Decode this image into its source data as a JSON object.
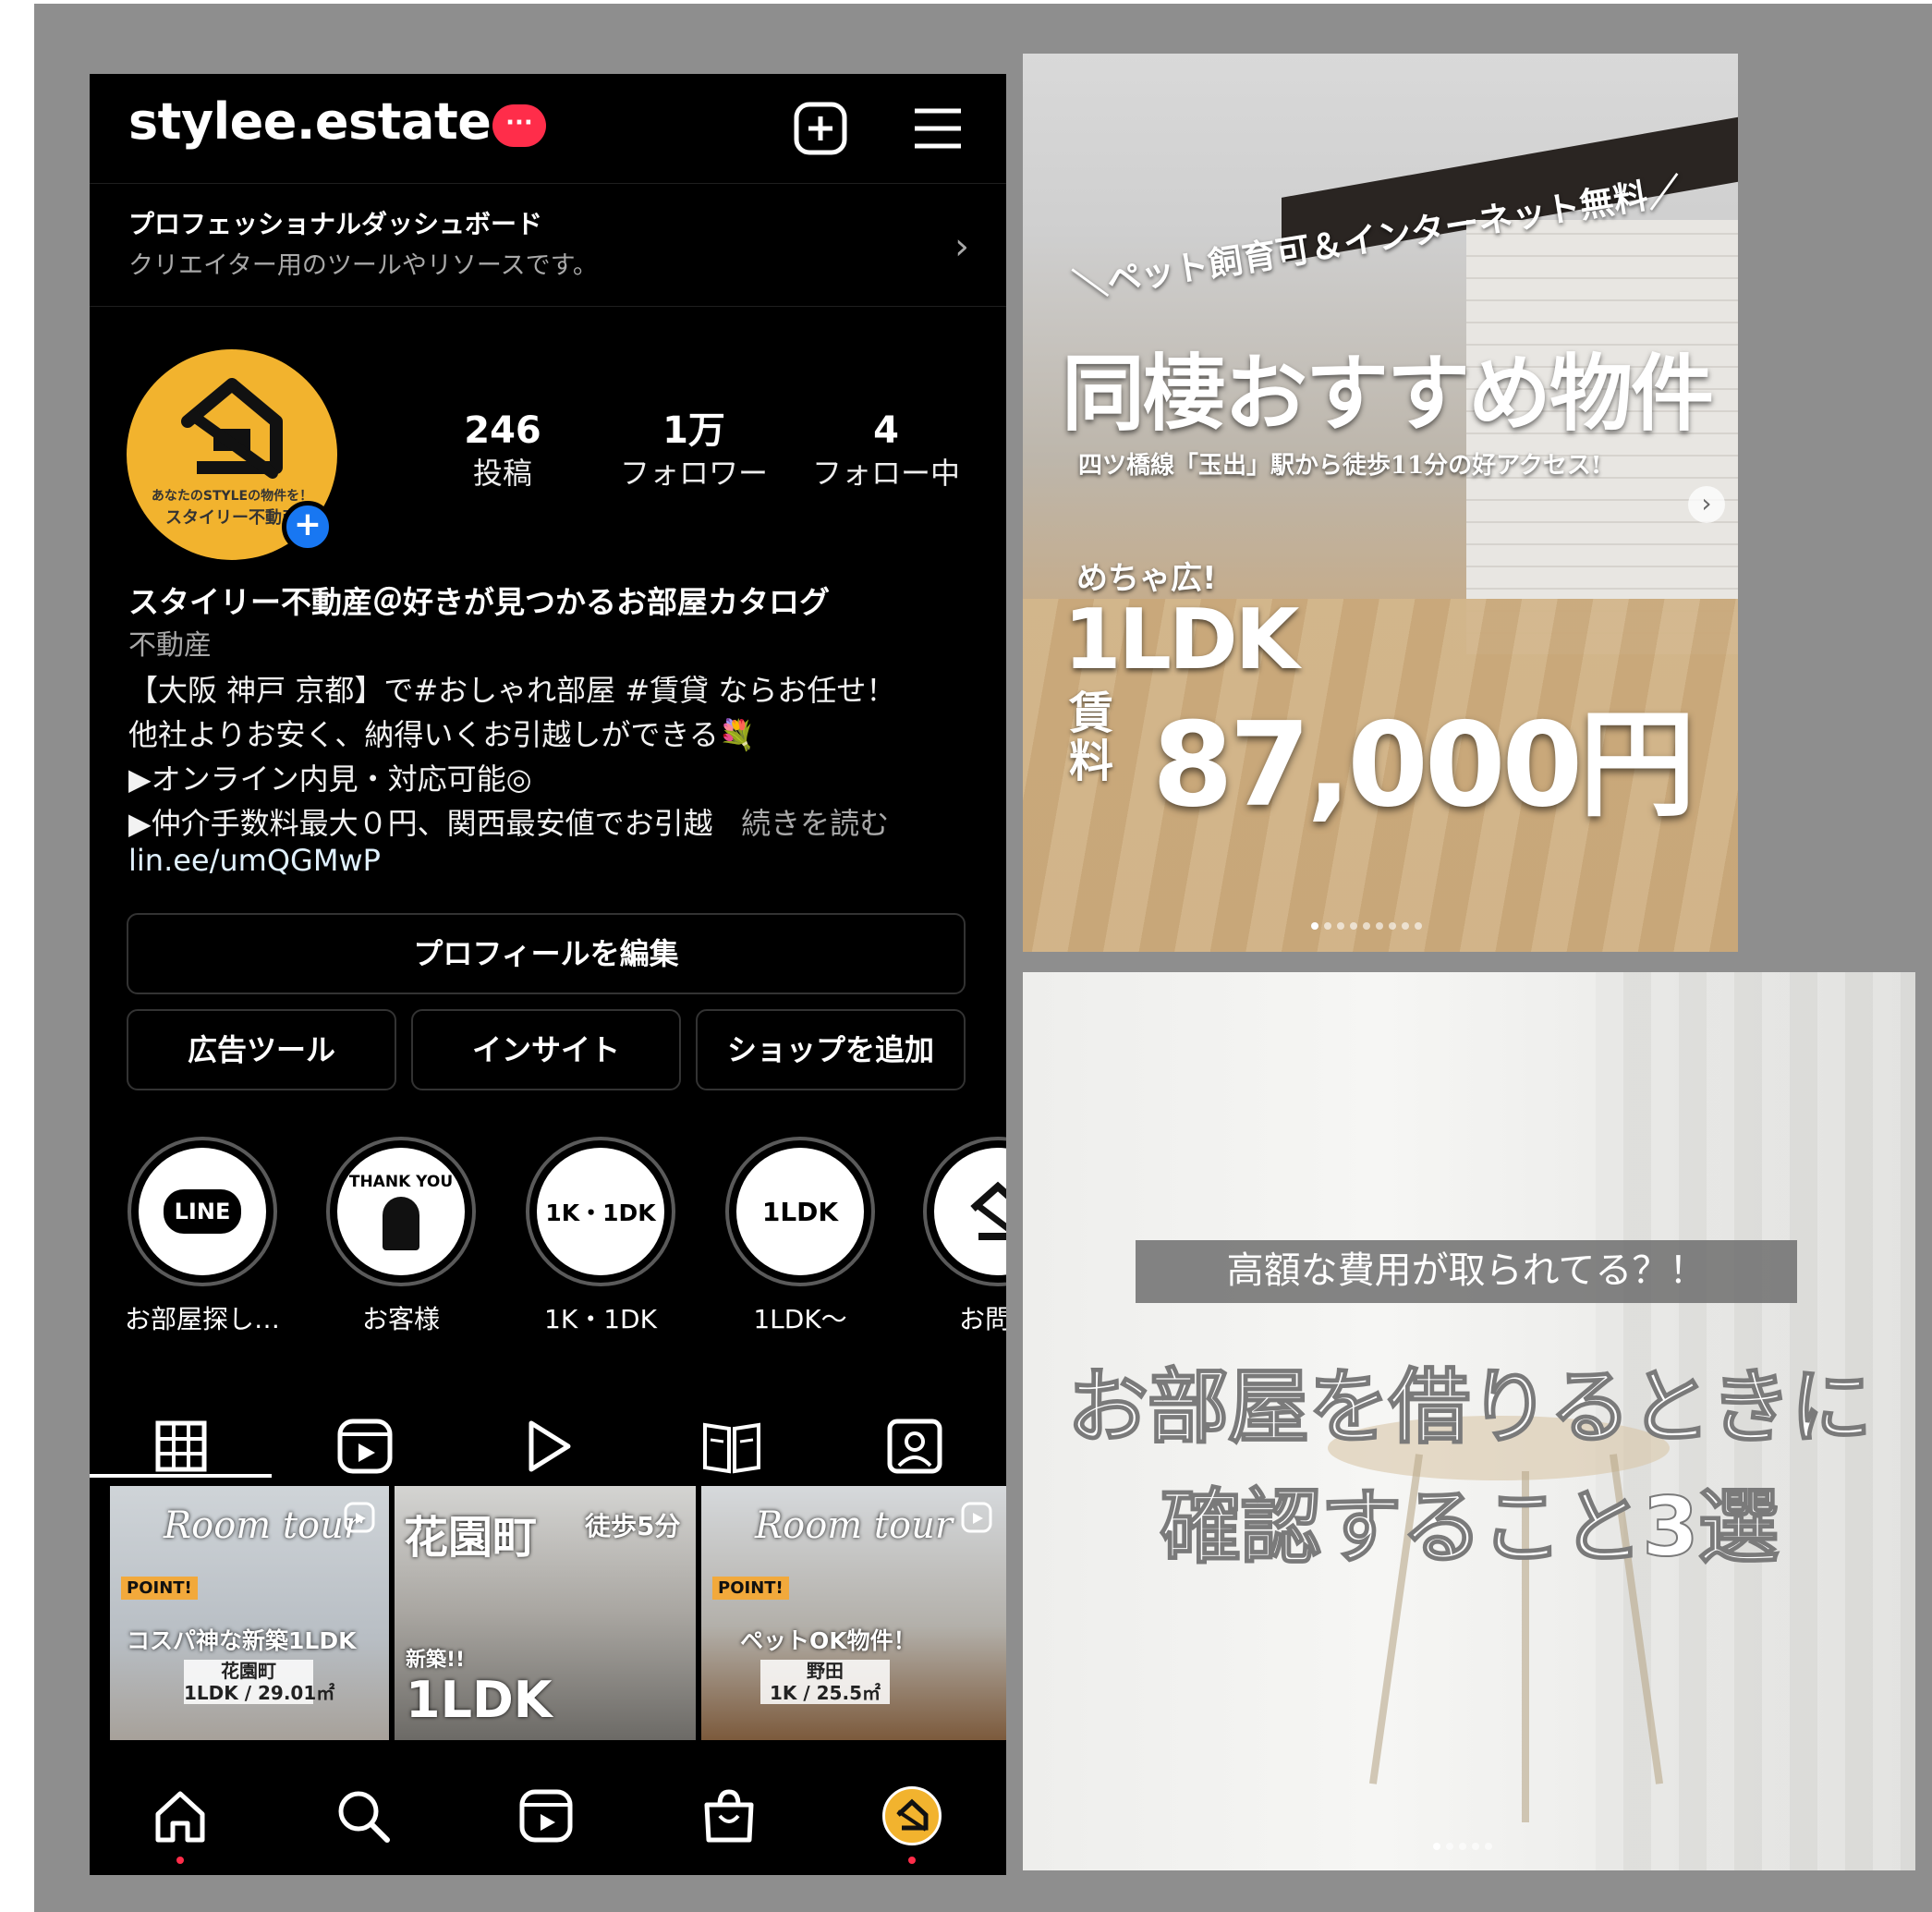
{
  "profile": {
    "username": "stylee.estate",
    "notif_badge": "···",
    "dashboard_title": "プロフェッショナルダッシュボード",
    "dashboard_sub": "クリエイター用のツールやリソースです。",
    "avatar_text_1": "あなたのSTYLEの物件を！",
    "avatar_text_2": "スタイリー不動産",
    "stats": [
      {
        "num": "246",
        "label": "投稿"
      },
      {
        "num": "1万",
        "label": "フォロワー"
      },
      {
        "num": "4",
        "label": "フォロー中"
      }
    ],
    "name": "スタイリー不動産＠好きが見つかるお部屋カタログ",
    "category": "不動産",
    "bio": [
      "【大阪 神戸 京都】で#おしゃれ部屋 #賃貸 ならお任せ！",
      "他社よりお安く、納得いくお引越しができる💐",
      "▶オンライン内見・対応可能◎",
      "▶仲介手数料最大０円、関西最安値でお引越"
    ],
    "more": "続きを読む",
    "link": "lin.ee/umQGMwP"
  },
  "buttons": {
    "edit_profile": "プロフィールを編集",
    "ad_tools": "広告ツール",
    "insights": "インサイト",
    "add_shop": "ショップを追加"
  },
  "highlights": [
    {
      "label": "お部屋探し…",
      "cover": "LINE"
    },
    {
      "label": "お客様",
      "cover": "THANK YOU"
    },
    {
      "label": "1K・1DK",
      "cover": "1K・1DK"
    },
    {
      "label": "1LDK～",
      "cover": "1LDK"
    },
    {
      "label": "お問い",
      "cover": ""
    }
  ],
  "grid_posts": [
    {
      "script": "Room tour",
      "point": "POINT!",
      "caption": "コスパ神な新築1LDK",
      "place": "花園町",
      "spec": "1LDK / 29.01㎡"
    },
    {
      "title": "花園町",
      "walk": "徒歩5分",
      "new": "新築!!",
      "ldk": "1LDK"
    },
    {
      "script": "Room tour",
      "point": "POINT!",
      "caption": "ペットOK物件！",
      "place": "野田",
      "spec": "1K / 25.5㎡"
    }
  ],
  "post1": {
    "tagline": "＼ペット飼育可＆インターネット無料／",
    "title": "同棲おすすめ物件",
    "access": "四ツ橋線「玉出」駅から徒歩11分の好アクセス!",
    "wide": "めちゃ広!",
    "layout": "1LDK",
    "rent_label": "賃料",
    "rent": "87,000円"
  },
  "post2": {
    "band": "高額な費用が取られてる？！",
    "title_1": "お部屋を借りるときに",
    "title_2": "確認すること3選"
  },
  "colors": {
    "frame": "#8e8e8e",
    "accent_red": "#ff2d4a",
    "avatar_yellow": "#f2b32e",
    "story_blue": "#1877f2"
  }
}
